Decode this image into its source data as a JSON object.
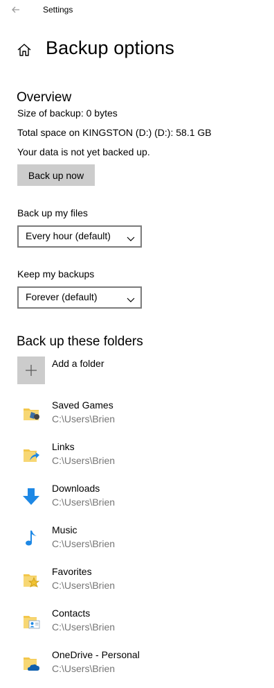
{
  "window": {
    "title": "Settings"
  },
  "page": {
    "title": "Backup options"
  },
  "overview": {
    "heading": "Overview",
    "size_line": "Size of backup: 0 bytes",
    "space_line": "Total space on KINGSTON (D:) (D:): 58.1 GB",
    "status_line": "Your data is not yet backed up.",
    "backup_button": "Back up now"
  },
  "frequency": {
    "label": "Back up my files",
    "selected": "Every hour (default)"
  },
  "retention": {
    "label": "Keep my backups",
    "selected": "Forever (default)"
  },
  "folders_section": {
    "heading": "Back up these folders",
    "add_label": "Add a folder",
    "items": [
      {
        "name": "Saved Games",
        "path": "C:\\Users\\Brien",
        "icon": "saved-games-folder-icon"
      },
      {
        "name": "Links",
        "path": "C:\\Users\\Brien",
        "icon": "links-folder-icon"
      },
      {
        "name": "Downloads",
        "path": "C:\\Users\\Brien",
        "icon": "downloads-arrow-icon"
      },
      {
        "name": "Music",
        "path": "C:\\Users\\Brien",
        "icon": "music-note-icon"
      },
      {
        "name": "Favorites",
        "path": "C:\\Users\\Brien",
        "icon": "favorites-folder-icon"
      },
      {
        "name": "Contacts",
        "path": "C:\\Users\\Brien",
        "icon": "contacts-folder-icon"
      },
      {
        "name": "OneDrive - Personal",
        "path": "C:\\Users\\Brien",
        "icon": "onedrive-folder-icon"
      }
    ]
  },
  "colors": {
    "button_gray": "#cccccc",
    "secondary_text": "#767676",
    "icon_blue": "#1e88e5",
    "folder_yellow": "#f3c74b"
  }
}
